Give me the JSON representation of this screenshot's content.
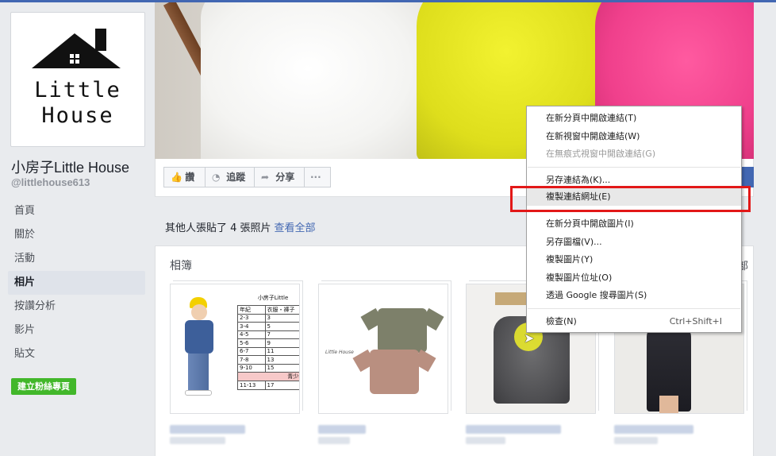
{
  "page": {
    "name": "小房子Little House",
    "handle": "@littlehouse613",
    "logo_line1": "Little",
    "logo_line2": "House"
  },
  "nav": {
    "items": [
      {
        "label": "首頁",
        "active": false
      },
      {
        "label": "關於",
        "active": false
      },
      {
        "label": "活動",
        "active": false
      },
      {
        "label": "相片",
        "active": true
      },
      {
        "label": "按讚分析",
        "active": false
      },
      {
        "label": "影片",
        "active": false
      },
      {
        "label": "貼文",
        "active": false
      }
    ],
    "create_label": "建立粉絲專頁"
  },
  "actions": {
    "like": "讚",
    "follow": "追蹤",
    "share": "分享",
    "more": "···"
  },
  "notice": {
    "text": "其他人張貼了 4 張照片",
    "link": "查看全部"
  },
  "albums": {
    "title": "相簿",
    "see_all_partial": "部",
    "size_table": {
      "title": "小房子Little",
      "header": [
        "年紀",
        "衣服・褲子"
      ],
      "rows": [
        [
          "2-3",
          "3"
        ],
        [
          "3-4",
          "5"
        ],
        [
          "4-5",
          "7"
        ],
        [
          "5-6",
          "9"
        ],
        [
          "6-7",
          "11"
        ],
        [
          "7-8",
          "13"
        ],
        [
          "9-10",
          "15"
        ]
      ],
      "highlight": "青少年(",
      "last_row": [
        "11-13",
        "17"
      ]
    },
    "album2_brand": "Little House"
  },
  "context_menu": {
    "items": [
      {
        "label": "在新分頁中開啟連結(T)",
        "disabled": false
      },
      {
        "label": "在新視窗中開啟連結(W)",
        "disabled": false
      },
      {
        "label": "在無痕式視窗中開啟連結(G)",
        "disabled": true
      },
      {
        "label": "另存連結為(K)...",
        "disabled": false
      },
      {
        "label": "複製連結網址(E)",
        "disabled": false,
        "highlighted": true
      },
      {
        "label": "在新分頁中開啟圖片(I)",
        "disabled": false
      },
      {
        "label": "另存圖檔(V)...",
        "disabled": false
      },
      {
        "label": "複製圖片(Y)",
        "disabled": false
      },
      {
        "label": "複製圖片位址(O)",
        "disabled": false
      },
      {
        "label": "透過 Google 搜尋圖片(S)",
        "disabled": false
      },
      {
        "label": "檢查(N)",
        "disabled": false,
        "shortcut": "Ctrl+Shift+I"
      }
    ]
  },
  "colors": {
    "brand_blue": "#4267b2",
    "create_green": "#42b72a",
    "highlight_red": "#e21818"
  }
}
